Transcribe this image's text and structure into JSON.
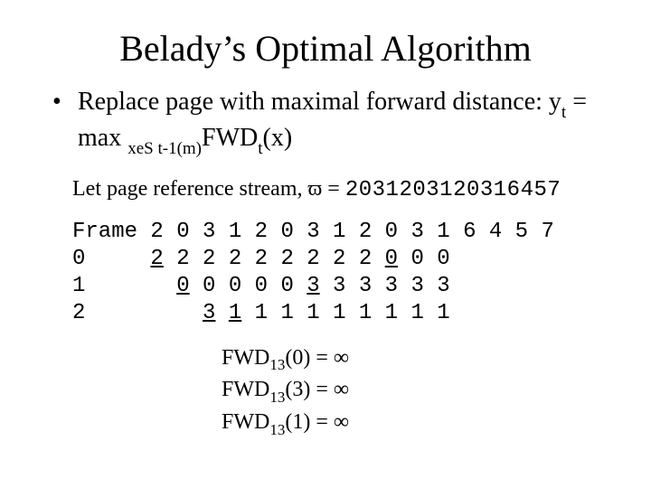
{
  "title": "Belady’s Optimal Algorithm",
  "bullet": {
    "dot": "•",
    "line_pre": "Replace page with maximal forward distance: y",
    "y_sub": "t",
    "eq": " = max ",
    "max_sub": "xeS t-1(m)",
    "fwd": "FWD",
    "fwd_sub": "t",
    "fwd_tail": "(x)"
  },
  "let_line": {
    "prefix": "Let page reference stream, ",
    "omega": "ϖ",
    "eq": " = ",
    "stream": "2031203120316457"
  },
  "table": {
    "header_label": "Frame",
    "row_labels": [
      "0",
      "1",
      "2"
    ],
    "header_cols": [
      "2",
      "0",
      "3",
      "1",
      "2",
      "0",
      "3",
      "1",
      "2",
      "0",
      "3",
      "1",
      "6",
      "4",
      "5",
      "7"
    ],
    "rows": [
      [
        "2̲",
        "2",
        "2",
        "2",
        "2",
        "2",
        "2",
        "2",
        "2",
        "0̲",
        "0",
        "0",
        "",
        "",
        "",
        ""
      ],
      [
        "",
        "0̲",
        "0",
        "0",
        "0",
        "0",
        "3̲",
        "3",
        "3",
        "3",
        "3",
        "3",
        "",
        "",
        "",
        ""
      ],
      [
        "",
        "",
        "3̲",
        "1̲",
        "1",
        "1",
        "1",
        "1",
        "1",
        "1",
        "1",
        "1",
        "",
        "",
        "",
        ""
      ]
    ]
  },
  "fwd": {
    "lines": [
      {
        "name": "FWD",
        "sub": "13",
        "arg": "(0) = ",
        "val": "∞"
      },
      {
        "name": "FWD",
        "sub": "13",
        "arg": "(3) = ",
        "val": "∞"
      },
      {
        "name": "FWD",
        "sub": "13",
        "arg": "(1) = ",
        "val": "∞"
      }
    ]
  }
}
